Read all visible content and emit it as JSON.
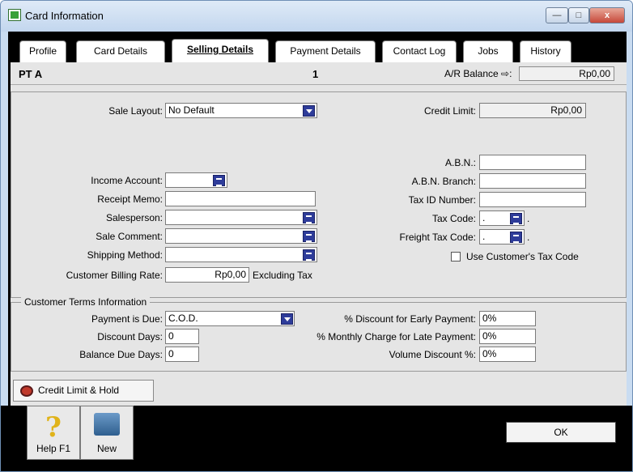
{
  "window": {
    "title": "Card Information",
    "minimize": "—",
    "maximize": "□",
    "close": "x"
  },
  "tabs": [
    {
      "label": "Profile"
    },
    {
      "label": "Card Details"
    },
    {
      "label": "Selling Details"
    },
    {
      "label": "Payment Details"
    },
    {
      "label": "Contact Log"
    },
    {
      "label": "Jobs"
    },
    {
      "label": "History"
    }
  ],
  "header": {
    "card_name": "PT A",
    "card_number": "1",
    "ar_label": "A/R Balance ⇨:",
    "ar_value": "Rp0,00"
  },
  "selling": {
    "sale_layout_label": "Sale Layout:",
    "sale_layout_value": "No Default",
    "income_account_label": "Income Account:",
    "income_account_value": "",
    "receipt_memo_label": "Receipt Memo:",
    "receipt_memo_value": "",
    "salesperson_label": "Salesperson:",
    "salesperson_value": "",
    "sale_comment_label": "Sale Comment:",
    "sale_comment_value": "",
    "shipping_method_label": "Shipping Method:",
    "shipping_method_value": "",
    "billing_rate_label": "Customer Billing Rate:",
    "billing_rate_value": "Rp0,00",
    "billing_rate_suffix": "Excluding Tax"
  },
  "right": {
    "credit_limit_label": "Credit Limit:",
    "credit_limit_value": "Rp0,00",
    "abn_label": "A.B.N.:",
    "abn_value": "",
    "abn_branch_label": "A.B.N. Branch:",
    "abn_branch_value": "",
    "tax_id_label": "Tax ID Number:",
    "tax_id_value": "",
    "tax_code_label": "Tax Code:",
    "tax_code_value": ".",
    "tax_code_suffix": ".",
    "freight_tax_label": "Freight Tax Code:",
    "freight_tax_value": ".",
    "freight_tax_suffix": ".",
    "use_customer_tax_label": "Use Customer's Tax Code"
  },
  "terms": {
    "legend": "Customer Terms Information",
    "payment_due_label": "Payment is Due:",
    "payment_due_value": "C.O.D.",
    "discount_days_label": "Discount Days:",
    "discount_days_value": "0",
    "balance_due_label": "Balance Due Days:",
    "balance_due_value": "0",
    "early_discount_label": "% Discount for Early Payment:",
    "early_discount_value": "0%",
    "late_charge_label": "% Monthly Charge for Late Payment:",
    "late_charge_value": "0%",
    "volume_discount_label": "Volume Discount %:",
    "volume_discount_value": "0%"
  },
  "buttons": {
    "credit_hold": "Credit Limit & Hold",
    "help": "Help F1",
    "new": "New",
    "ok": "OK"
  }
}
